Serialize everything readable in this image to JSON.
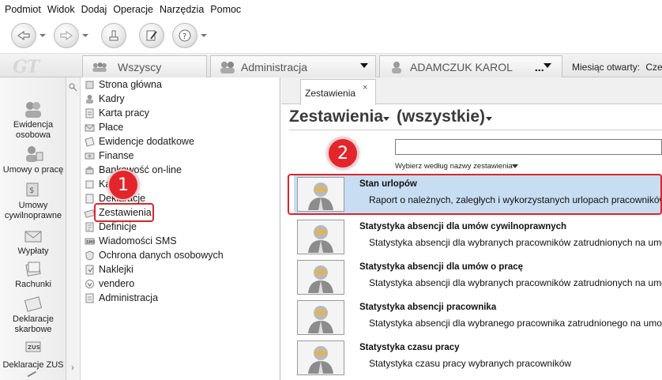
{
  "menu": [
    "Podmiot",
    "Widok",
    "Dodaj",
    "Operacje",
    "Narzędzia",
    "Pomoc"
  ],
  "toolbar": {
    "buttons": [
      "back-icon",
      "forward-icon",
      "stamp-icon",
      "edit-icon",
      "help-icon"
    ]
  },
  "logo_text": "GT",
  "context_tabs": {
    "all": "Wszyscy",
    "administration": "Administracja",
    "employee": "ADAMCZUK KAROL",
    "employee_more": "...",
    "month_label": "Miesiąc otwarty:",
    "month_value": "Czerw"
  },
  "left_sidebar": [
    {
      "label": "Ewidencja osobowa",
      "icon": "people-icon"
    },
    {
      "label": "Umowy o pracę",
      "icon": "person-contract-icon"
    },
    {
      "label": "Umowy cywilnoprawne",
      "icon": "money-contract-icon"
    },
    {
      "label": "Wypłaty",
      "icon": "envelope-money-icon"
    },
    {
      "label": "Rachunki",
      "icon": "bills-icon"
    },
    {
      "label": "Deklaracje skarbowe",
      "icon": "tax-declaration-icon"
    },
    {
      "label": "Deklaracje ZUS",
      "icon": "zus-icon"
    }
  ],
  "tree": [
    "Strona główna",
    "Kadry",
    "Karta pracy",
    "Płace",
    "Ewidencje dodatkowe",
    "Finanse",
    "Bankowość on-line",
    "Kartoteki",
    "Deklaracje",
    "Zestawienia",
    "Definicje",
    "Wiadomości SMS",
    "Ochrona danych osobowych",
    "Naklejki",
    "vendero",
    "Administracja"
  ],
  "doc_tab": {
    "label": "Zestawienia",
    "close": "×"
  },
  "heading": {
    "section": "Zestawienia",
    "filter": "(wszystkie)"
  },
  "search": {
    "value": "",
    "hint": "Wybierz według nazwy zestawienia"
  },
  "reports": [
    {
      "title": "Stan urlopów",
      "description": "Raport o należnych, zaległych i wykorzystanych urlopach pracowników"
    },
    {
      "title": "Statystyka absencji dla umów cywilnoprawnych",
      "description": "Statystyka absencji dla wybranych pracowników zatrudnionych na umow"
    },
    {
      "title": "Statystyka absencji dla umów o pracę",
      "description": "Statystyka absencji dla wybranych pracowników zatrudnionych na umow"
    },
    {
      "title": "Statystyka absencji pracownika",
      "description": "Statystyka absencji dla wybranego pracownika zatrudnionego na umow"
    },
    {
      "title": "Statystyka czasu pracy",
      "description": "Statystyka czasu pracy wybranych pracowników"
    }
  ],
  "annotations": {
    "step1": "1",
    "step2": "2"
  },
  "colors": {
    "selection": "#c7ddf2",
    "annotation_red": "#e3262c"
  }
}
